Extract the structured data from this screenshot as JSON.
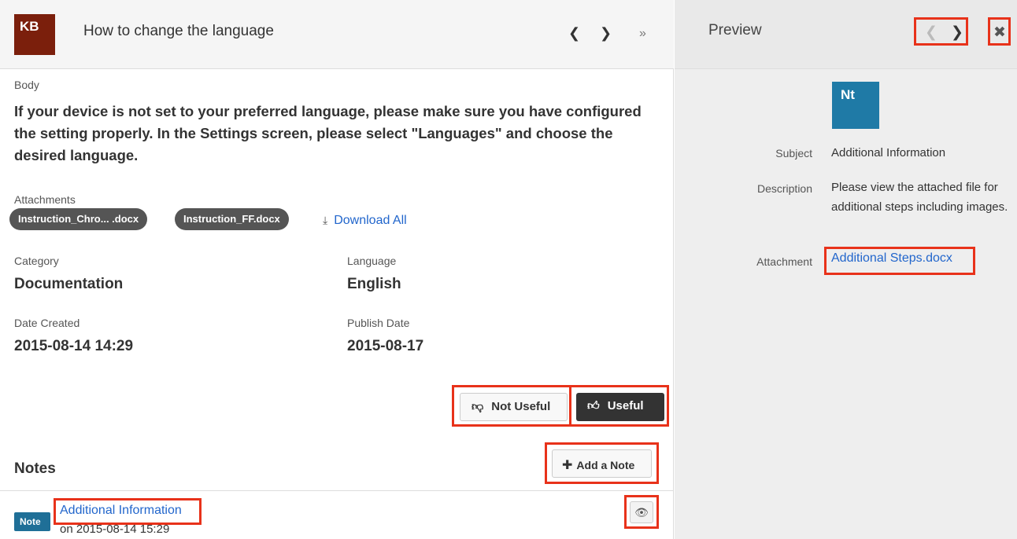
{
  "record": {
    "avatar": "KB",
    "title": "How to change the language",
    "nav_prev": "‹",
    "nav_next": "›",
    "nav_expand": "»"
  },
  "body": {
    "label": "Body",
    "text": "If your device is not set to your preferred language, please make sure you have configured the setting properly. In the Settings screen, please select \"Languages\" and choose the desired language."
  },
  "attachments": {
    "label": "Attachments",
    "files": [
      "Instruction_Chro... .docx",
      "Instruction_FF.docx"
    ],
    "download_all": "Download All"
  },
  "fields": {
    "category_label": "Category",
    "category_value": "Documentation",
    "language_label": "Language",
    "language_value": "English",
    "date_created_label": "Date Created",
    "date_created_value": "2015-08-14 14:29",
    "publish_date_label": "Publish Date",
    "publish_date_value": "2015-08-17"
  },
  "feedback": {
    "not_useful": "Not Useful",
    "useful": "Useful"
  },
  "notes": {
    "title": "Notes",
    "add_note": "Add a Note",
    "items": [
      {
        "badge": "Note",
        "title": "Additional Information",
        "date": "on 2015-08-14 15:29"
      }
    ]
  },
  "preview": {
    "title": "Preview",
    "avatar": "Nt",
    "subject_label": "Subject",
    "subject_value": "Additional Information",
    "description_label": "Description",
    "description_value": "Please view the attached file for additional steps including images.",
    "attachment_label": "Attachment",
    "attachment_value": "Additional Steps.docx"
  },
  "colors": {
    "highlight": "#e8321a",
    "link": "#2266cc",
    "kb_avatar": "#7b1f0c",
    "note_avatar": "#1f7aa6",
    "note_badge": "#1f6f97"
  }
}
